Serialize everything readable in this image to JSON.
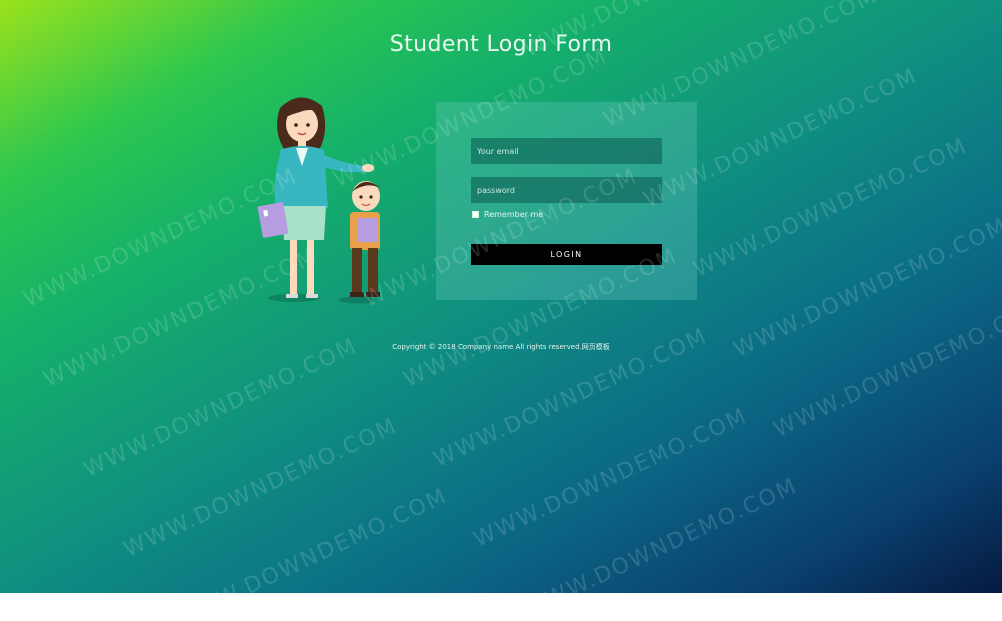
{
  "page": {
    "title": "Student Login Form",
    "copyright": "Copyright © 2018 Company name All rights reserved.网页模板",
    "watermark": "WWW.DOWNDEMO.COM"
  },
  "form": {
    "email_placeholder": "Your email",
    "password_placeholder": "password",
    "remember_label": "Remember me",
    "remember_checked": false,
    "login_label": "LOGIN"
  },
  "illustration": {
    "icon": "teacher-and-student-illustration"
  },
  "colors": {
    "gradient_start": "#9be21c",
    "gradient_mid": "#0f8c82",
    "gradient_end": "#061a40",
    "panel": "#6fd0c8",
    "button": "#000000"
  }
}
